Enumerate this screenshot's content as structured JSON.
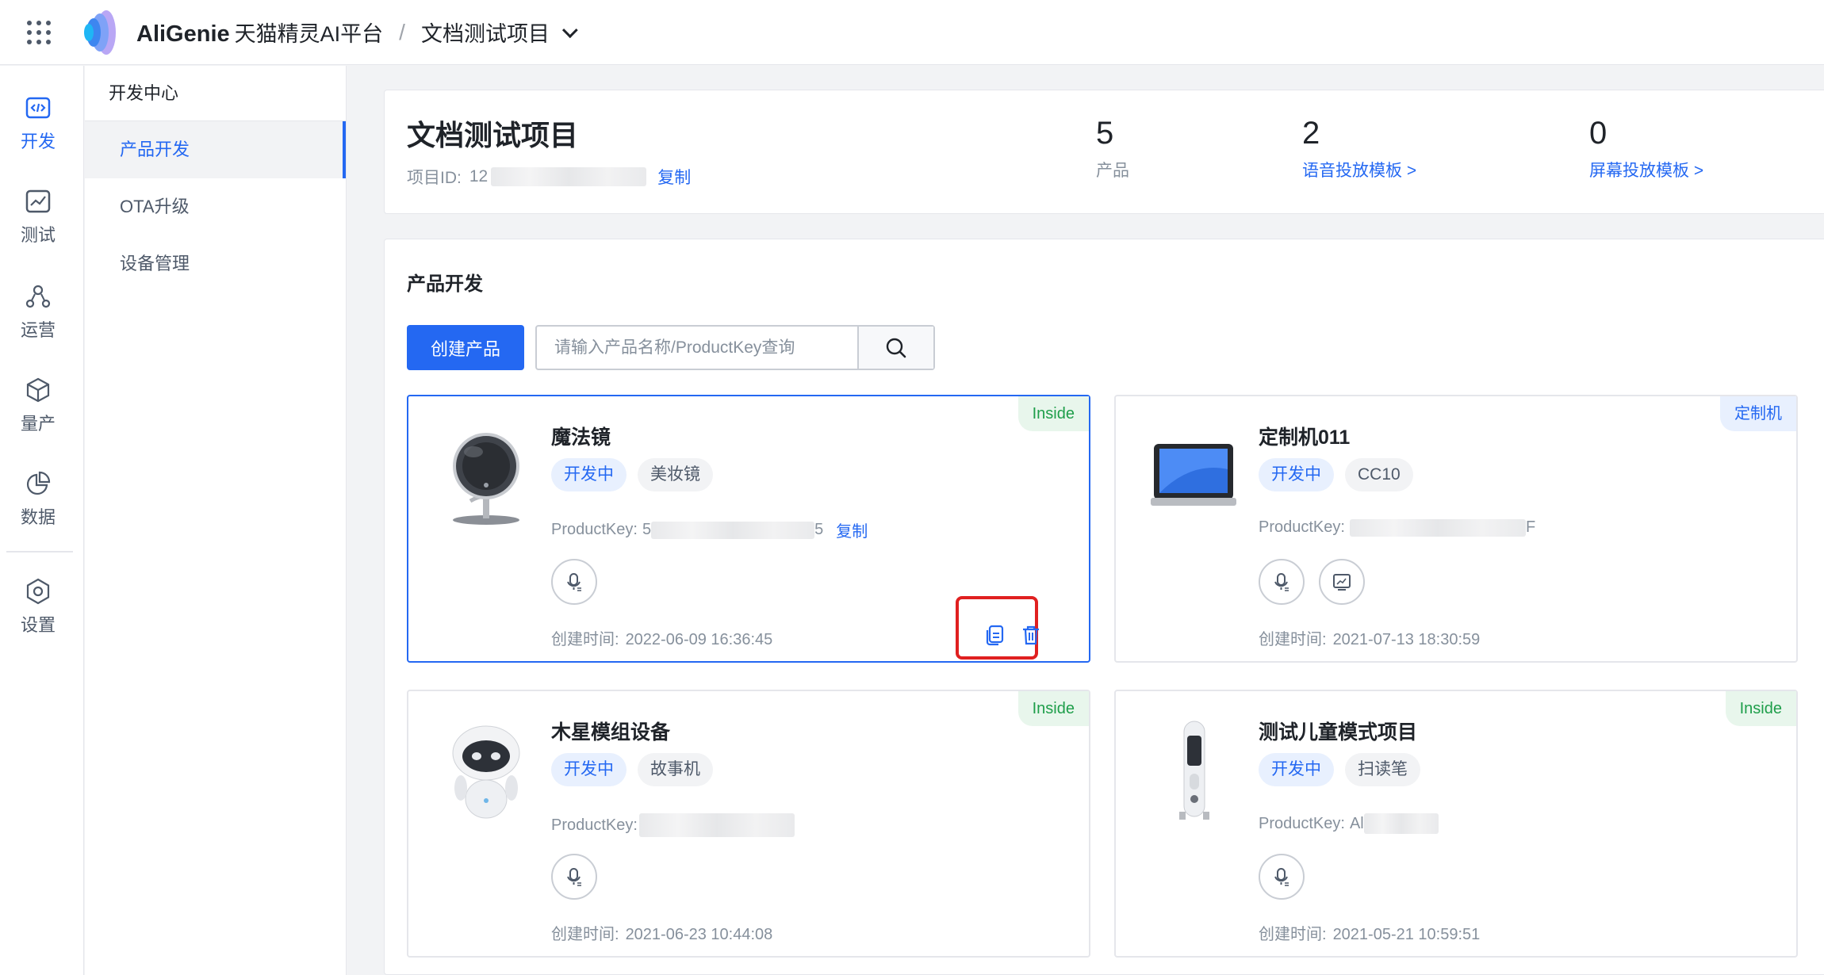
{
  "topbar": {
    "brand": "AliGenie",
    "brand_cn": "天猫精灵AI平台",
    "separator": "/",
    "project": "文档测试项目"
  },
  "rail": {
    "items": [
      {
        "label": "开发",
        "icon": "code-icon",
        "active": true
      },
      {
        "label": "测试",
        "icon": "chart-line-icon"
      },
      {
        "label": "运营",
        "icon": "nodes-icon"
      },
      {
        "label": "量产",
        "icon": "cube-icon"
      },
      {
        "label": "数据",
        "icon": "pie-chart-icon"
      },
      {
        "label": "设置",
        "icon": "hexagon-gear-icon"
      }
    ]
  },
  "subnav": {
    "title": "开发中心",
    "items": [
      {
        "label": "产品开发",
        "active": true
      },
      {
        "label": "OTA升级"
      },
      {
        "label": "设备管理"
      }
    ]
  },
  "project": {
    "name": "文档测试项目",
    "id_label": "项目ID:",
    "id_visible_prefix": "12",
    "copy": "复制",
    "stats": [
      {
        "value": "5",
        "label": "产品"
      },
      {
        "value": "2",
        "label": "语音投放模板 >"
      },
      {
        "value": "0",
        "label": "屏幕投放模板 >"
      }
    ]
  },
  "products": {
    "title": "产品开发",
    "create_button": "创建产品",
    "search_placeholder": "请输入产品名称/ProductKey查询",
    "cards": [
      {
        "name": "魔法镜",
        "status": "开发中",
        "category": "美妆镜",
        "key_label": "ProductKey:",
        "key_start": "5",
        "key_end": "5",
        "copy": "复制",
        "time_label": "创建时间:",
        "time": "2022-06-09 16:36:45",
        "badge": "Inside"
      },
      {
        "name": "定制机011",
        "status": "开发中",
        "category": "CC10",
        "key_label": "ProductKey:",
        "key_start": "",
        "key_end": "F",
        "time_label": "创建时间:",
        "time": "2021-07-13 18:30:59",
        "badge": "定制机"
      },
      {
        "name": "木星模组设备",
        "status": "开发中",
        "category": "故事机",
        "key_label": "ProductKey:",
        "time_label": "创建时间:",
        "time": "2021-06-23 10:44:08",
        "badge": "Inside"
      },
      {
        "name": "测试儿童模式项目",
        "status": "开发中",
        "category": "扫读笔",
        "key_label": "ProductKey:",
        "key_start": "Al",
        "time_label": "创建时间:",
        "time": "2021-05-21 10:59:51",
        "badge": "Inside"
      }
    ]
  },
  "colors": {
    "accent": "#2468f2",
    "inside_green": "#1e9e4a",
    "highlight_red": "#e02020"
  }
}
